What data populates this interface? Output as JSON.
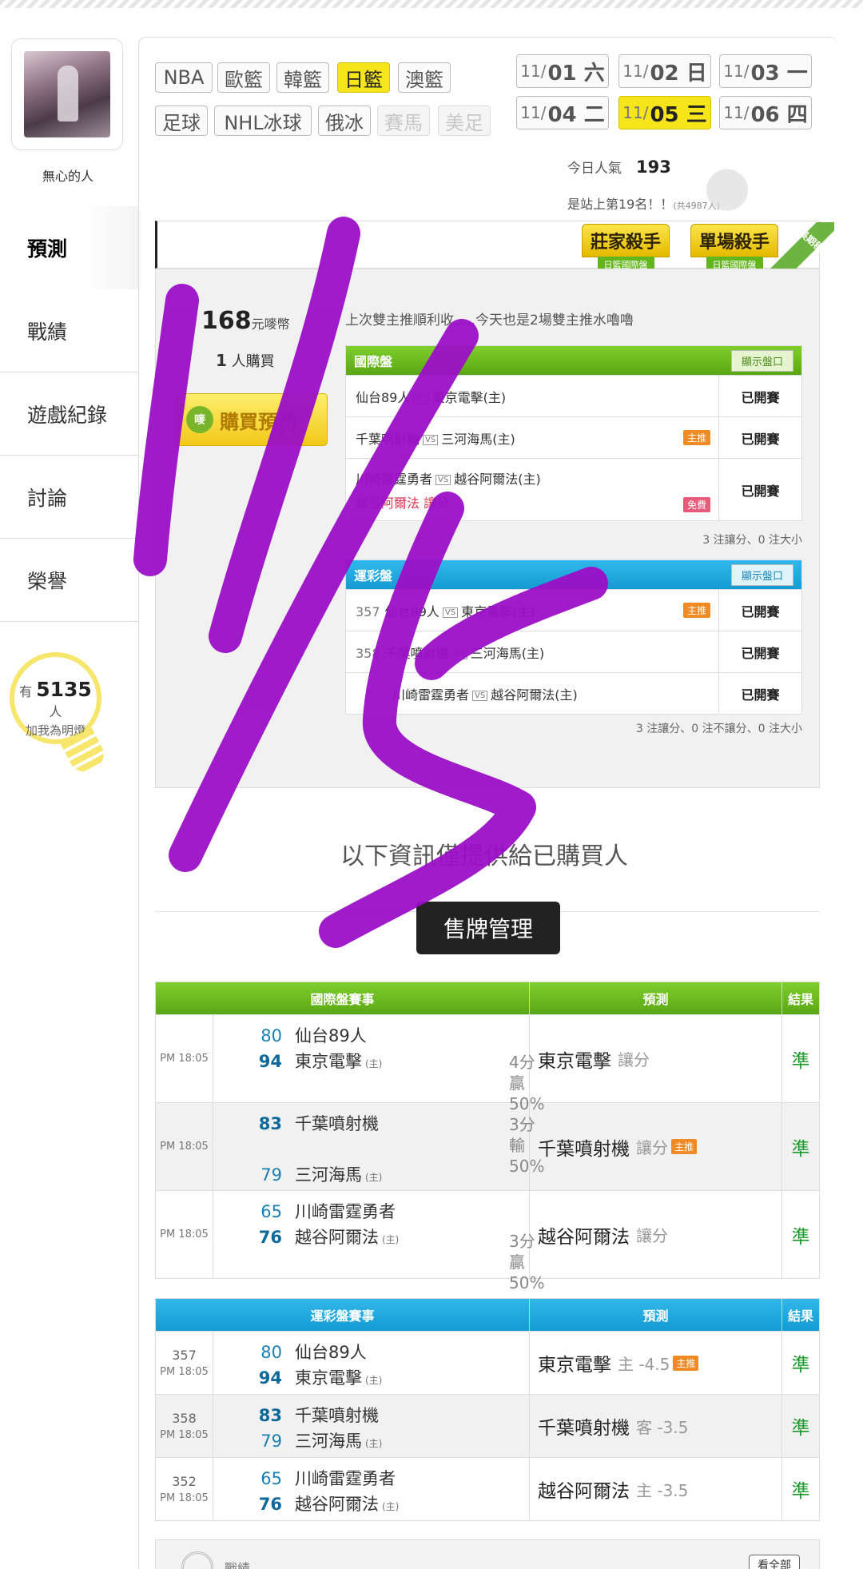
{
  "user": {
    "name": "無心的人"
  },
  "sidebar": {
    "items": [
      {
        "label": "預測"
      },
      {
        "label": "戰績"
      },
      {
        "label": "遊戲紀錄"
      },
      {
        "label": "討論"
      },
      {
        "label": "榮譽"
      }
    ]
  },
  "fans": {
    "prefix": "有",
    "count": "5135",
    "unit": "人",
    "caption": "加我為明燈"
  },
  "sports": [
    "NBA",
    "歐籃",
    "韓籃",
    "日籃",
    "澳籃",
    "足球",
    "NHL冰球",
    "俄冰",
    "賽馬",
    "美足"
  ],
  "dates": [
    {
      "md": "11/",
      "d": "01 六"
    },
    {
      "md": "11/",
      "d": "02 日"
    },
    {
      "md": "11/",
      "d": "03 一"
    },
    {
      "md": "11/",
      "d": "04 二"
    },
    {
      "md": "11/",
      "d": "05 三"
    },
    {
      "md": "11/",
      "d": "06 四"
    }
  ],
  "popularity": {
    "label": "今日人氣",
    "value": "193"
  },
  "rank": {
    "text": "是站上第19名！！",
    "total": "(共4987人)"
  },
  "badges": [
    {
      "title": "莊家殺手",
      "sub": "日籃國際盤"
    },
    {
      "title": "單場殺手",
      "sub": "日籃國際盤"
    }
  ],
  "ribbon": "長期穩定",
  "pick": {
    "price": "168",
    "price_unit": "元嘜幣",
    "buyers": "1",
    "buyers_unit": "人購買",
    "buy_button": "購買預測",
    "coin": "嘜",
    "note": "上次雙主推順利收.....今天也是2場雙主推水嚕嚕"
  },
  "intl_mini": {
    "title": "國際盤",
    "show": "顯示盤口",
    "rows": [
      {
        "away": "仙台89人",
        "home": "東京電擊(主)",
        "tag": "",
        "extra": "",
        "status": "已開賽"
      },
      {
        "away": "千葉噴射機",
        "home": "三河海馬(主)",
        "tag": "主推",
        "extra": "",
        "status": "已開賽"
      },
      {
        "away": "川崎雷霆勇者",
        "home": "越谷阿爾法(主)",
        "tag": "免費",
        "extra": "越谷阿爾法  讓分",
        "status": "已開賽"
      }
    ],
    "summary": "3 注讓分、0 注大小"
  },
  "sports_mini": {
    "title": "運彩盤",
    "show": "顯示盤口",
    "rows": [
      {
        "id": "357",
        "away": "仙台89人",
        "home": "東京電擊(主)",
        "tag": "主推",
        "status": "已開賽"
      },
      {
        "id": "358",
        "away": "千葉噴射機",
        "home": "三河海馬(主)",
        "tag": "",
        "status": "已開賽"
      },
      {
        "id": "",
        "away": "川崎雷霆勇者",
        "home": "越谷阿爾法(主)",
        "tag": "",
        "status": "已開賽"
      }
    ],
    "summary": "3 注讓分、0 注不讓分、0 注大小"
  },
  "info_line": "以下資訊僅提供給已購買人",
  "sale_button": "售牌管理",
  "intl_results": {
    "headers": [
      "國際盤賽事",
      "預測",
      "結果"
    ],
    "rows": [
      {
        "time": "PM 18:05",
        "id": "",
        "t1": {
          "score": "80",
          "name": "仙台89人",
          "win": false,
          "home": false
        },
        "t2": {
          "score": "94",
          "name": "東京電擊",
          "win": true,
          "home": true
        },
        "margin1": "4分贏",
        "margin2": "50%",
        "pick": "東京電擊",
        "pick_type": "讓分",
        "tag": "",
        "result": "準"
      },
      {
        "time": "PM 18:05",
        "id": "",
        "t1": {
          "score": "83",
          "name": "千葉噴射機",
          "win": true,
          "home": false
        },
        "t2": {
          "score": "79",
          "name": "三河海馬",
          "win": false,
          "home": true
        },
        "margin1": "3分輸",
        "margin2": "50%",
        "pick": "千葉噴射機",
        "pick_type": "讓分",
        "tag": "主推",
        "result": "準"
      },
      {
        "time": "PM 18:05",
        "id": "",
        "t1": {
          "score": "65",
          "name": "川崎雷霆勇者",
          "win": false,
          "home": false
        },
        "t2": {
          "score": "76",
          "name": "越谷阿爾法",
          "win": true,
          "home": true
        },
        "margin1": "3分贏",
        "margin2": "50%",
        "pick": "越谷阿爾法",
        "pick_type": "讓分",
        "tag": "",
        "result": "準"
      }
    ]
  },
  "sports_results": {
    "headers": [
      "運彩盤賽事",
      "預測",
      "結果"
    ],
    "rows": [
      {
        "time": "PM 18:05",
        "id": "357",
        "t1": {
          "score": "80",
          "name": "仙台89人",
          "win": false,
          "home": false
        },
        "t2": {
          "score": "94",
          "name": "東京電擊",
          "win": true,
          "home": true
        },
        "pick": "東京電擊",
        "pick_type": "主 -4.5",
        "tag": "主推",
        "result": "準"
      },
      {
        "time": "PM 18:05",
        "id": "358",
        "t1": {
          "score": "83",
          "name": "千葉噴射機",
          "win": true,
          "home": false
        },
        "t2": {
          "score": "79",
          "name": "三河海馬",
          "win": false,
          "home": true
        },
        "pick": "千葉噴射機",
        "pick_type": "客 -3.5",
        "tag": "",
        "result": "準"
      },
      {
        "time": "PM 18:05",
        "id": "352",
        "t1": {
          "score": "65",
          "name": "川崎雷霆勇者",
          "win": false,
          "home": false
        },
        "t2": {
          "score": "76",
          "name": "越谷阿爾法",
          "win": true,
          "home": true
        },
        "pick": "越谷阿爾法",
        "pick_type": "主 -3.5",
        "tag": "",
        "result": "準"
      }
    ]
  },
  "home_mark": "(主)",
  "bottom": {
    "label": "戰績",
    "all_button": "看全部"
  },
  "colors": {
    "accent_yellow": "#f7e51c",
    "green_header": "#6cbd20",
    "blue_header": "#1fa9df",
    "scribble": "#9b0fc7"
  }
}
